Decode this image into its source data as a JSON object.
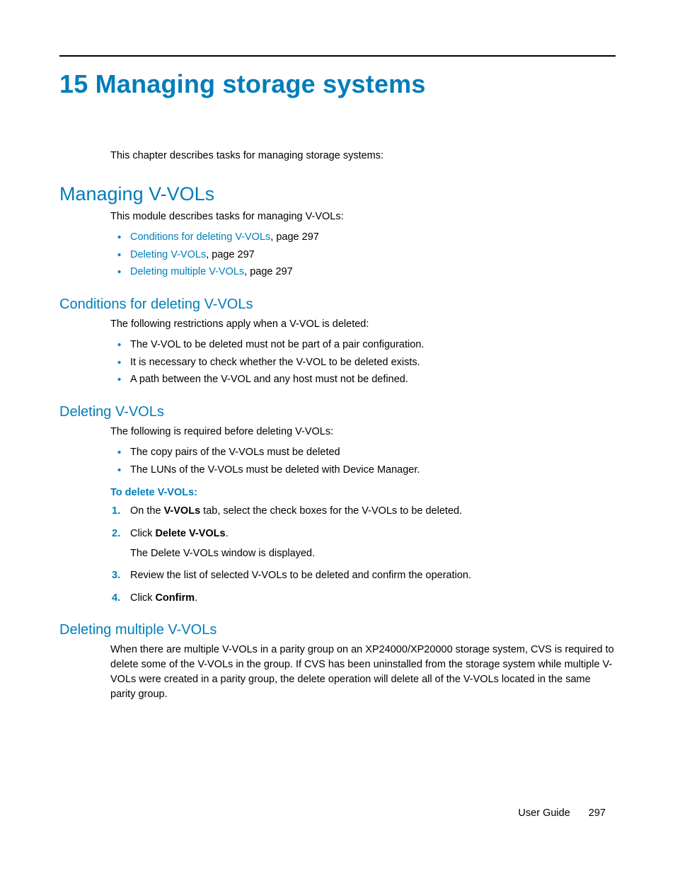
{
  "chapter": {
    "number": "15",
    "title": "Managing storage systems",
    "intro": "This chapter describes tasks for managing storage systems:"
  },
  "section_managing": {
    "heading": "Managing V-VOLs",
    "intro": "This module describes tasks for managing V-VOLs:",
    "links": [
      {
        "text": "Conditions for deleting V-VOLs",
        "suffix": ", page 297"
      },
      {
        "text": "Deleting V-VOLs",
        "suffix": ", page 297"
      },
      {
        "text": "Deleting multiple V-VOLs",
        "suffix": ", page 297"
      }
    ]
  },
  "section_conditions": {
    "heading": "Conditions for deleting V-VOLs",
    "intro": "The following restrictions apply when a V-VOL is deleted:",
    "items": [
      "The V-VOL to be deleted must not be part of a pair configuration.",
      "It is necessary to check whether the V-VOL to be deleted exists.",
      "A path between the V-VOL and any host must not be defined."
    ]
  },
  "section_deleting": {
    "heading": "Deleting V-VOLs",
    "intro": "The following is required before deleting V-VOLs:",
    "prereqs": [
      "The copy pairs of the V-VOLs must be deleted",
      "The LUNs of the V-VOLs must be deleted with Device Manager."
    ],
    "proc_title": "To delete V-VOLs:",
    "steps": {
      "s1a": "On the ",
      "s1b": "V-VOLs",
      "s1c": " tab, select the check boxes for the V-VOLs to be deleted.",
      "s2a": "Click ",
      "s2b": "Delete V-VOLs",
      "s2c": ".",
      "s2_sub": "The Delete V-VOLs window is displayed.",
      "s3": "Review the list of selected V-VOLs to be deleted and confirm the operation.",
      "s4a": "Click ",
      "s4b": "Confirm",
      "s4c": "."
    }
  },
  "section_multiple": {
    "heading": "Deleting multiple V-VOLs",
    "body": "When there are multiple V-VOLs in a parity group on an XP24000/XP20000 storage system, CVS is required to delete some of the V-VOLs in the group. If CVS has been uninstalled from the storage system while multiple V-VOLs were created in a parity group, the delete operation will delete all of the V-VOLs located in the same parity group."
  },
  "footer": {
    "label": "User Guide",
    "page": "297"
  }
}
